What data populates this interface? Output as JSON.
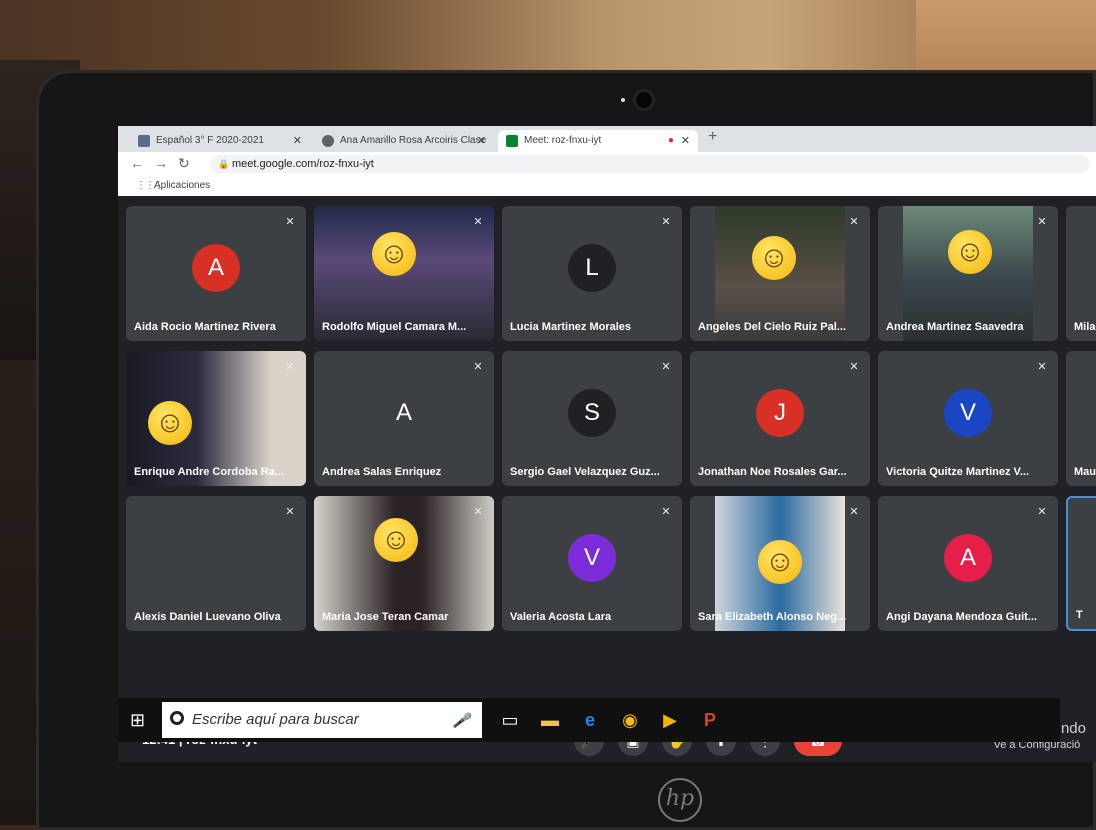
{
  "browser": {
    "tabs": [
      {
        "label": "Español 3° F 2020-2021"
      },
      {
        "label": "Ana Amarillo Rosa Arcoiris Clase"
      },
      {
        "label": "Meet: roz-fnxu-iyt"
      }
    ],
    "new_tab": "+",
    "url": "meet.google.com/roz-fnxu-iyt",
    "bookmarks_label": "Aplicaciones"
  },
  "participants": [
    {
      "name": "Aida Rocio Martinez Rivera",
      "initial": "A",
      "color": "#d93025"
    },
    {
      "name": "Rodolfo Miguel Camara M...",
      "initial": "",
      "color": "#3c4043"
    },
    {
      "name": "Lucia Martinez Morales",
      "initial": "L",
      "color": "#202124"
    },
    {
      "name": "Angeles Del Cielo Ruiz Pal...",
      "initial": "",
      "color": "#3c4043"
    },
    {
      "name": "Andrea Martinez Saavedra",
      "initial": "",
      "color": "#3c4043"
    },
    {
      "name": "Milagros",
      "initial": "",
      "color": "#3c4043"
    },
    {
      "name": "Enrique Andre Cordoba Ra...",
      "initial": "",
      "color": "#3c4043"
    },
    {
      "name": "Andrea Salas Enriquez",
      "initial": "A",
      "color": "#3c4043"
    },
    {
      "name": "Sergio Gael Velazquez Guz...",
      "initial": "S",
      "color": "#202124"
    },
    {
      "name": "Jonathan Noe Rosales Gar...",
      "initial": "J",
      "color": "#d93025"
    },
    {
      "name": "Victoria Quitze Martinez V...",
      "initial": "V",
      "color": "#1a46c4"
    },
    {
      "name": "Maur",
      "initial": "",
      "color": "#3c4043"
    },
    {
      "name": "Alexis Daniel Luevano Oliva",
      "initial": "",
      "color": "#3c4043"
    },
    {
      "name": "Maria Jose Teran Camar",
      "initial": "",
      "color": "#3c4043"
    },
    {
      "name": "Valeria Acosta Lara",
      "initial": "V",
      "color": "#7c2bdb"
    },
    {
      "name": "Sara Elizabeth Alonso Neg...",
      "initial": "",
      "color": "#3c4043"
    },
    {
      "name": "Angi Dayana Mendoza Guit...",
      "initial": "A",
      "color": "#e51f49"
    },
    {
      "name": "T",
      "initial": "",
      "color": "#3c4043"
    }
  ],
  "meeting": {
    "time": "12:41",
    "separator": "|",
    "code": "roz-fnxu-iyt"
  },
  "activation": {
    "line1": "Activar Windo",
    "line2": "Ve a Configuració"
  },
  "taskbar": {
    "search_placeholder": "Escribe aquí para buscar"
  },
  "laptop_brand": "hp"
}
